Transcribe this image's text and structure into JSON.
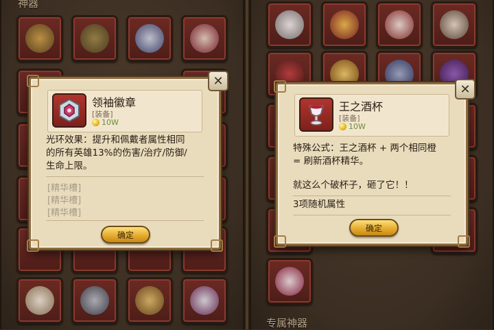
{
  "left_panel": {
    "section_label": "神器"
  },
  "right_panel": {
    "section_label": "专属神器"
  },
  "left_dialog": {
    "item_name": "领袖徽章",
    "item_type": "[装备]",
    "price": "10W",
    "description_lines": [
      "光环效果：提升和佩戴者属性相同",
      "的所有英雄13%的伤害/治疗/防御/",
      "生命上限。"
    ],
    "sockets": [
      "[精华槽]",
      "[精华槽]",
      "[精华槽]"
    ],
    "confirm_label": "确定",
    "close_glyph": "✕"
  },
  "right_dialog": {
    "item_name": "王之酒杯",
    "item_type": "[装备]",
    "price": "10W",
    "description_lines": [
      "特殊公式：王之酒杯 + 两个相同橙",
      "= 刷新酒杯精华。"
    ],
    "flavor_text": "就这么个破杯子，砸了它！！",
    "attribute_text": "3项随机属性",
    "confirm_label": "确定",
    "close_glyph": "✕"
  }
}
